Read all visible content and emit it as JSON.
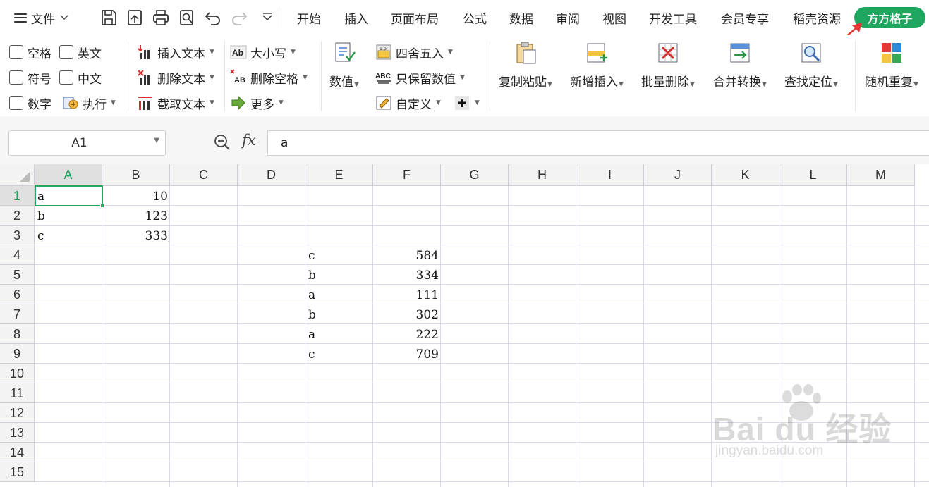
{
  "menubar": {
    "file_label": "文件",
    "tabs": [
      "开始",
      "插入",
      "页面布局",
      "公式",
      "数据",
      "审阅",
      "视图",
      "开发工具",
      "会员专享",
      "稻壳资源"
    ],
    "active_tab": "方方格子"
  },
  "ribbon": {
    "checkboxes": [
      {
        "label": "空格"
      },
      {
        "label": "英文"
      },
      {
        "label": "符号"
      },
      {
        "label": "中文"
      },
      {
        "label": "数字"
      }
    ],
    "execute_label": "执行",
    "text_group": [
      "插入文本",
      "删除文本",
      "截取文本"
    ],
    "case_group": [
      "大小写",
      "删除空格",
      "更多"
    ],
    "value_label": "数值",
    "round_group": [
      "四舍五入",
      "只保留数值",
      "自定义"
    ],
    "big_buttons": [
      "复制粘贴",
      "新增插入",
      "批量删除",
      "合并转换",
      "查找定位",
      "随机重复"
    ]
  },
  "formula": {
    "cell_ref": "A1",
    "fx_label": "fx",
    "content": "a"
  },
  "sheet": {
    "columns": [
      "A",
      "B",
      "C",
      "D",
      "E",
      "F",
      "G",
      "H",
      "I",
      "J",
      "K",
      "L",
      "M"
    ],
    "rows": [
      "1",
      "2",
      "3",
      "4",
      "5",
      "6",
      "7",
      "8",
      "9",
      "10",
      "11",
      "12",
      "13",
      "14",
      "15"
    ],
    "table1": [
      {
        "name": "a",
        "value": "10"
      },
      {
        "name": "b",
        "value": "123"
      },
      {
        "name": "c",
        "value": "333"
      }
    ],
    "table2": [
      {
        "name": "c",
        "value": "584"
      },
      {
        "name": "b",
        "value": "334"
      },
      {
        "name": "a",
        "value": "111"
      },
      {
        "name": "b",
        "value": "302"
      },
      {
        "name": "a",
        "value": "222"
      },
      {
        "name": "c",
        "value": "709"
      }
    ]
  },
  "watermark": {
    "text": "Bai du 经验",
    "sub": "jingyan.baidu.com"
  },
  "colors": {
    "accent": "#1fa760",
    "annotation_arrow": "#e53935"
  }
}
